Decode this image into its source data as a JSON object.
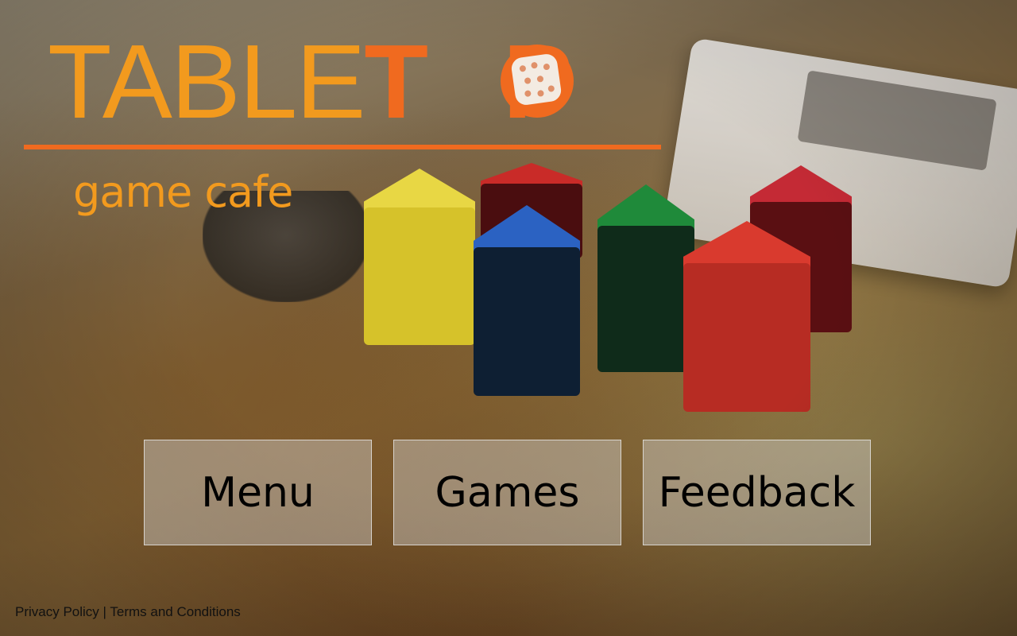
{
  "brand": {
    "title_part1": "TABLE",
    "title_part2": "T",
    "title_part3": "P",
    "tagline": "game cafe",
    "colors": {
      "light_orange": "#f29a1e",
      "dark_orange": "#f06a1f"
    }
  },
  "nav": {
    "items": [
      {
        "label": "Menu"
      },
      {
        "label": "Games"
      },
      {
        "label": "Feedback"
      }
    ]
  },
  "footer": {
    "privacy_label": "Privacy Policy",
    "separator": " | ",
    "terms_label": "Terms and Conditions"
  }
}
